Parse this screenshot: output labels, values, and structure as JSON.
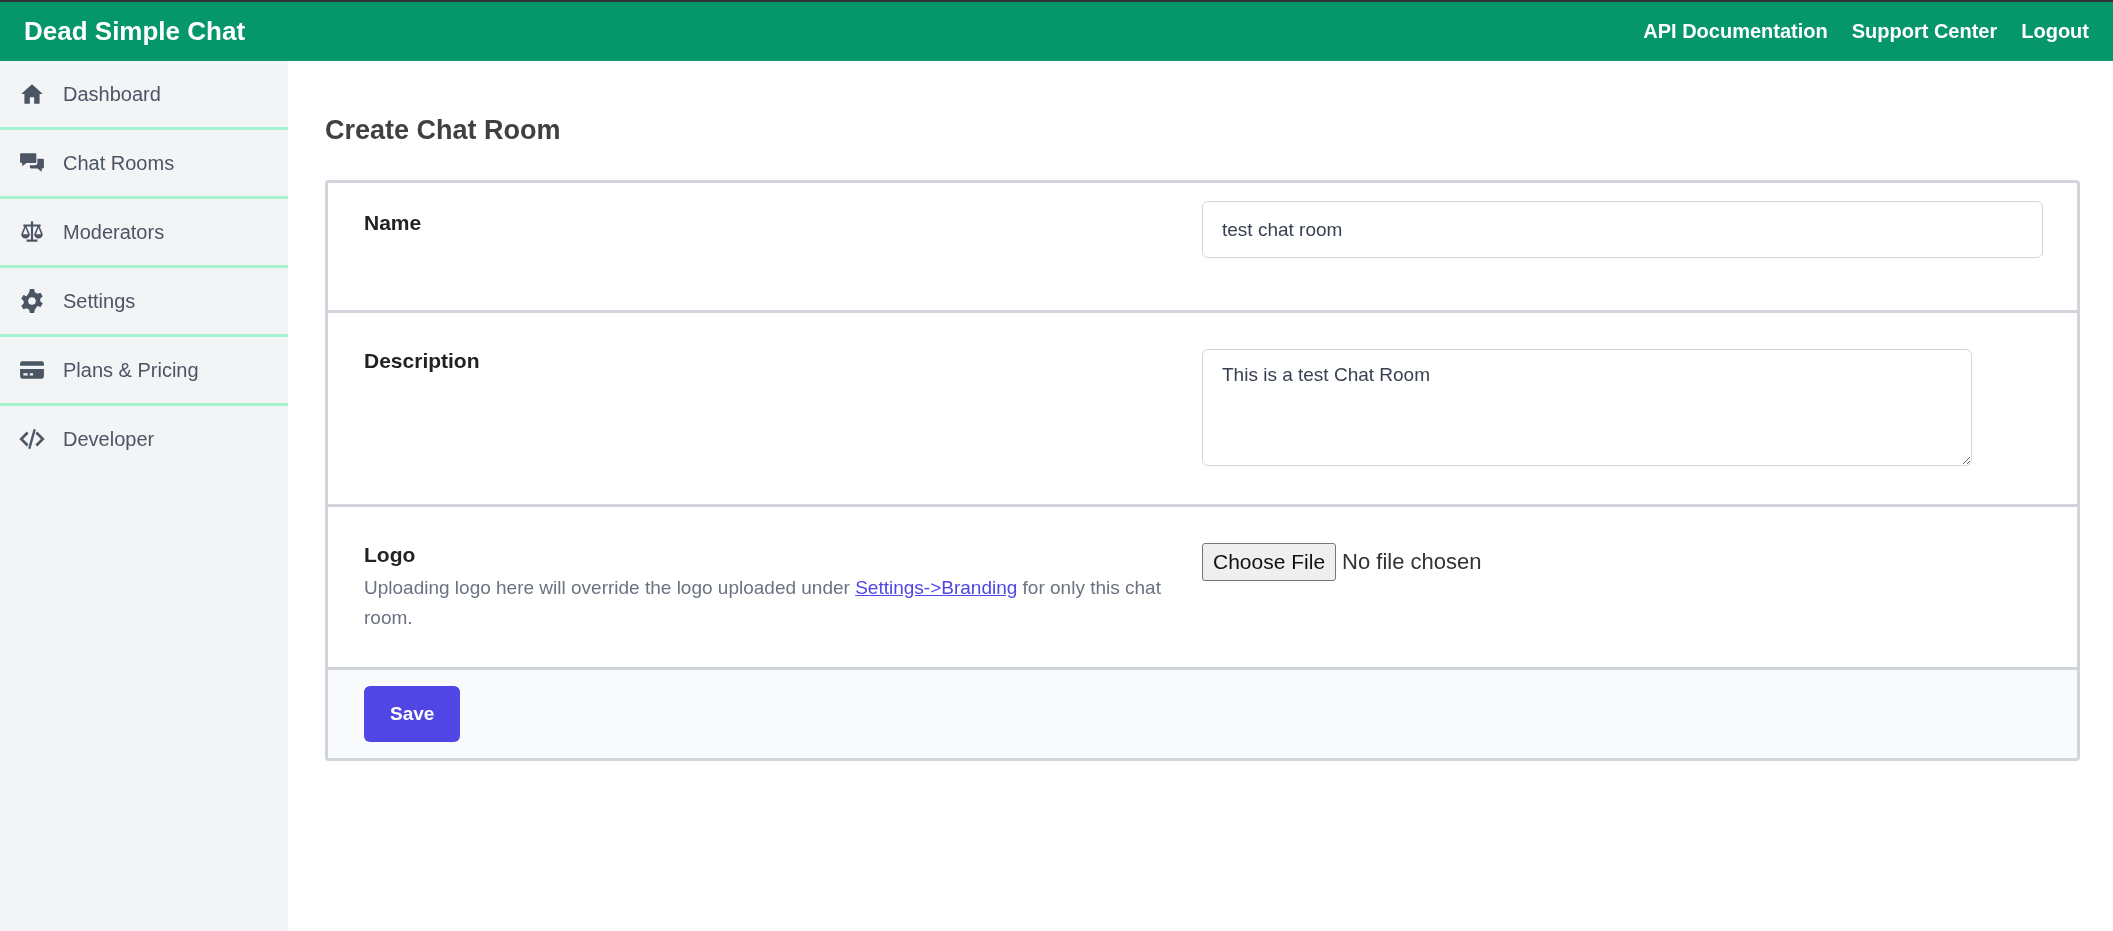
{
  "header": {
    "brand": "Dead Simple Chat",
    "links": [
      "API Documentation",
      "Support Center",
      "Logout"
    ]
  },
  "sidebar": {
    "items": [
      {
        "label": "Dashboard"
      },
      {
        "label": "Chat Rooms"
      },
      {
        "label": "Moderators"
      },
      {
        "label": "Settings"
      },
      {
        "label": "Plans & Pricing"
      },
      {
        "label": "Developer"
      }
    ]
  },
  "page_title": "Create Chat Room",
  "form": {
    "fields": [
      {
        "kind": "text",
        "label": "Name",
        "value": "test chat room"
      },
      {
        "kind": "textarea",
        "label": "Description",
        "value": "This is a test Chat Room"
      },
      {
        "kind": "file",
        "label": "Logo",
        "help_before": "Uploading logo here will override the logo uploaded under ",
        "help_link": "Settings->Branding",
        "help_after": " for only this chat room.",
        "button": "Choose File",
        "status": "No file chosen"
      }
    ],
    "submit": "Save"
  }
}
